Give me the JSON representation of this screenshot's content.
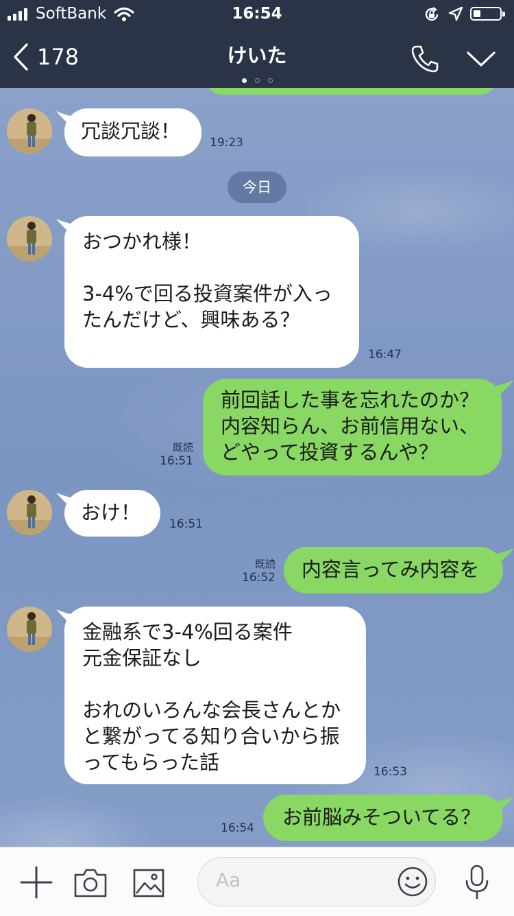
{
  "status_bar": {
    "carrier": "SoftBank",
    "time": "16:54"
  },
  "header": {
    "back_count": "178",
    "title": "けいた"
  },
  "date_separator": "今日",
  "messages": [
    {
      "side": "in",
      "text": "冗談冗談！",
      "time": "19:23"
    },
    {
      "side": "in",
      "text": "おつかれ様！\n\n3-4%で回る投資案件が入っ\nたんだけど、興味ある？",
      "time": "16:47"
    },
    {
      "side": "out",
      "text": "前回話した事を忘れたのか？\n内容知らん、お前信用ない、\nどやって投資するんや？",
      "read": "既読",
      "time": "16:51"
    },
    {
      "side": "in",
      "text": "おけ！",
      "time": "16:51"
    },
    {
      "side": "out",
      "text": "内容言ってみ内容を",
      "read": "既読",
      "time": "16:52"
    },
    {
      "side": "in",
      "text": "金融系で3-4%回る案件\n元金保証なし\n\nおれのいろんな会長さんとか\nと繋がってる知り合いから振\nってもらった話",
      "time": "16:53"
    },
    {
      "side": "out",
      "text": "お前脳みそついてる？",
      "time": "16:54"
    }
  ],
  "input": {
    "placeholder": "Aa"
  },
  "colors": {
    "header_bg": "#2b3447",
    "chat_bg": "#7f9ac4",
    "outgoing_bubble": "#88d863",
    "incoming_bubble": "#ffffff"
  },
  "icons": [
    "signal-icon",
    "wifi-icon",
    "orientation-lock-icon",
    "location-icon",
    "battery-icon",
    "back-chevron-icon",
    "phone-icon",
    "chevron-down-icon",
    "plus-icon",
    "camera-icon",
    "image-icon",
    "emoji-icon",
    "microphone-icon"
  ]
}
